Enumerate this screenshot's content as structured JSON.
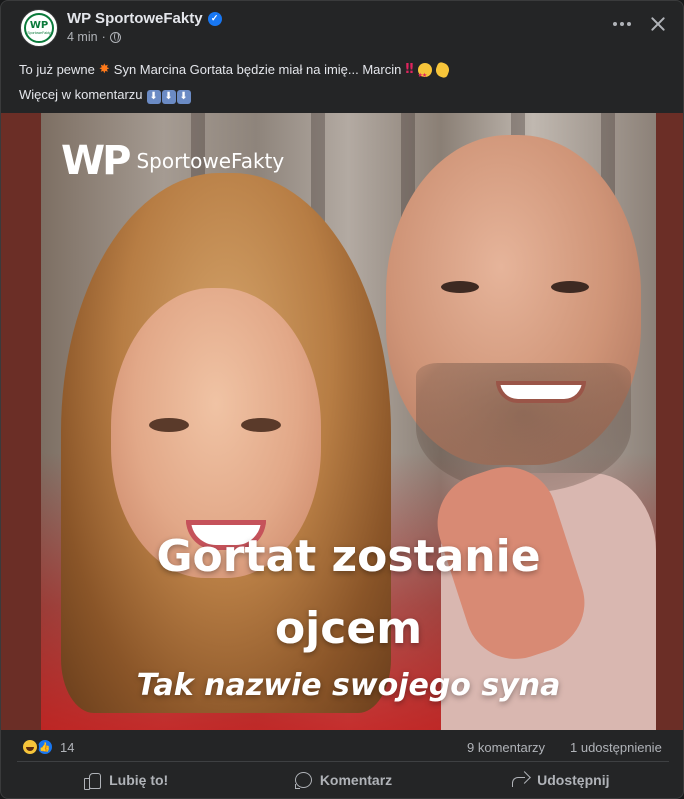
{
  "post": {
    "page_name": "WP SportoweFakty",
    "avatar_text": "WP",
    "avatar_subtext": "SportoweFakty",
    "timestamp": "4 min",
    "meta_separator": "·",
    "text_line1": "To już pewne",
    "text_line1_b": "Syn Marcina Gortata będzie miał na imię... Marcin",
    "text_line2": "Więcej w komentarzu",
    "emojis": {
      "boom": "✸",
      "double_exclamation": "‼"
    },
    "down_arrow": "⬇"
  },
  "media": {
    "brand_logo_text": "WP",
    "brand_name": "SportoweFakty",
    "headline_line1": "Gortat zostanie",
    "headline_line2": "ojcem",
    "headline_sub": "Tak nazwie swojego syna"
  },
  "stats": {
    "reaction_count": "14",
    "comments": "9 komentarzy",
    "shares": "1 udostępnienie"
  },
  "actions": {
    "like": "Lubię to!",
    "comment": "Komentarz",
    "share": "Udostępnij"
  },
  "colors": {
    "background": "#242526",
    "text_primary": "#e4e6eb",
    "text_secondary": "#b0b3b8",
    "verified": "#1877f2",
    "media_border": "#6b2e26"
  }
}
